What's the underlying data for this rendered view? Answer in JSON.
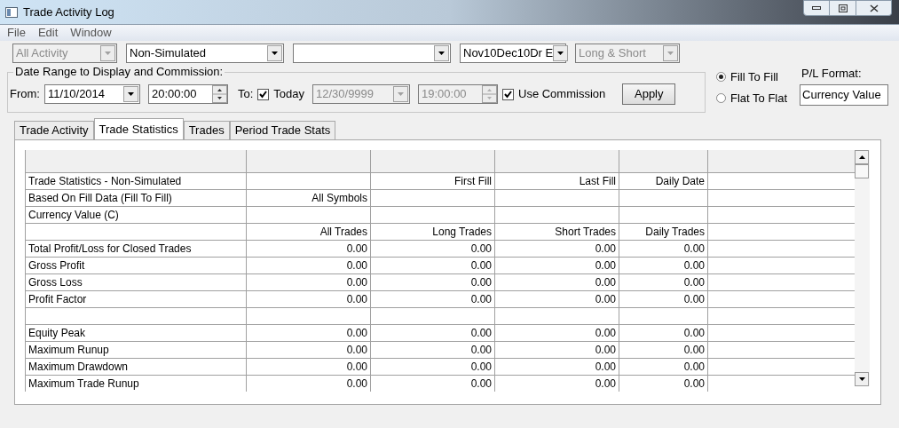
{
  "window": {
    "title": "Trade Activity Log"
  },
  "menu": [
    "File",
    "Edit",
    "Window"
  ],
  "filters": [
    {
      "value": "All Activity",
      "disabled": true
    },
    {
      "value": "Non-Simulated",
      "disabled": false
    },
    {
      "disabled": false
    },
    {
      "value": "Nov10Dec10Dr E",
      "disabled": false
    },
    {
      "value": "Long & Short",
      "disabled": true
    }
  ],
  "date_range": {
    "title": "Date Range to Display and Commission:",
    "from_label": "From:",
    "from_date": "11/10/2014",
    "from_time": "20:00:00",
    "to_label": "To:",
    "today": {
      "label": "Today",
      "checked": true
    },
    "to_date": {
      "value": "12/30/9999",
      "disabled": true
    },
    "to_time": {
      "value": "19:00:00",
      "disabled": true
    },
    "commission": {
      "label": "Use Commission",
      "checked": true
    },
    "apply": "Apply"
  },
  "fill_mode": [
    {
      "label": "Fill To Fill",
      "selected": true
    },
    {
      "label": "Flat To Flat",
      "selected": false
    }
  ],
  "pl_format": {
    "label": "P/L Format:",
    "value": "Currency Value"
  },
  "tabs": [
    {
      "label": "Trade Activity",
      "selected": false
    },
    {
      "label": "Trade Statistics",
      "selected": true
    },
    {
      "label": "Trades",
      "selected": false
    },
    {
      "label": "Period Trade Stats",
      "selected": false
    }
  ],
  "table": {
    "rows": [
      [
        "Trade Statistics - Non-Simulated",
        null,
        "First Fill",
        "Last Fill",
        "Daily Date"
      ],
      [
        "Based On Fill Data (Fill To Fill)",
        "All Symbols",
        null,
        null,
        null
      ],
      [
        "Currency Value (C)",
        null,
        null,
        null,
        null
      ],
      [
        null,
        "All Trades",
        "Long Trades",
        "Short Trades",
        "Daily Trades"
      ],
      [
        "Total Profit/Loss for Closed Trades",
        "0.00",
        "0.00",
        "0.00",
        "0.00"
      ],
      [
        "Gross Profit",
        "0.00",
        "0.00",
        "0.00",
        "0.00"
      ],
      [
        "Gross Loss",
        "0.00",
        "0.00",
        "0.00",
        "0.00"
      ],
      [
        "Profit Factor",
        "0.00",
        "0.00",
        "0.00",
        "0.00"
      ],
      [
        null,
        null,
        null,
        null,
        null
      ],
      [
        "Equity Peak",
        "0.00",
        "0.00",
        "0.00",
        "0.00"
      ],
      [
        "Maximum Runup",
        "0.00",
        "0.00",
        "0.00",
        "0.00"
      ],
      [
        "Maximum Drawdown",
        "0.00",
        "0.00",
        "0.00",
        "0.00"
      ],
      [
        "Maximum Trade Runup",
        "0.00",
        "0.00",
        "0.00",
        "0.00"
      ]
    ]
  }
}
